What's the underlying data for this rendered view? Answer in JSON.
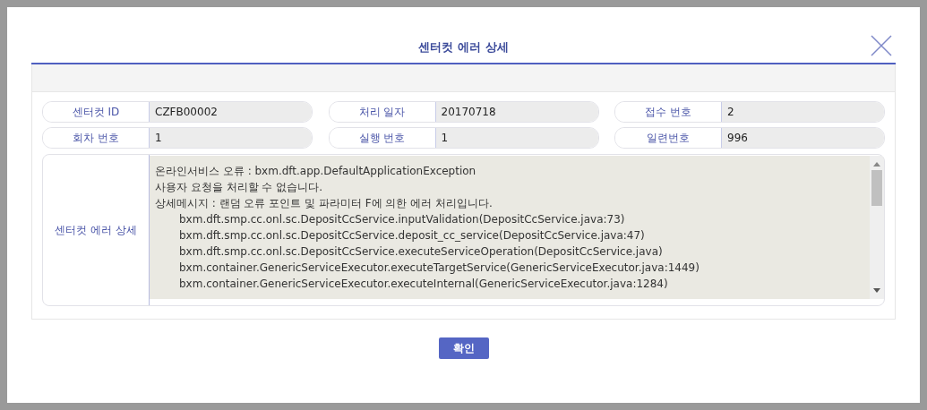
{
  "dialog": {
    "title": "센터컷 에러 상세"
  },
  "fields": [
    {
      "label": "센터컷 ID",
      "value": "CZFB00002"
    },
    {
      "label": "처리 일자",
      "value": "20170718"
    },
    {
      "label": "접수 번호",
      "value": "2"
    },
    {
      "label": "회차 번호",
      "value": "1"
    },
    {
      "label": "실행 번호",
      "value": "1"
    },
    {
      "label": "일련번호",
      "value": "996"
    }
  ],
  "error_detail": {
    "label": "센터컷 에러 상세",
    "lines": [
      {
        "kind": "message",
        "text": "온라인서비스 오류 : bxm.dft.app.DefaultApplicationException"
      },
      {
        "kind": "message",
        "text": "사용자 요청을 처리할 수 없습니다."
      },
      {
        "kind": "message",
        "text": "상세메시지 : 랜덤 오류 포인트 및 파라미터 F에 의한 에러 처리입니다."
      },
      {
        "kind": "trace",
        "text": "bxm.dft.smp.cc.onl.sc.DepositCcService.inputValidation(DepositCcService.java:73)"
      },
      {
        "kind": "trace",
        "text": "bxm.dft.smp.cc.onl.sc.DepositCcService.deposit_cc_service(DepositCcService.java:47)"
      },
      {
        "kind": "trace",
        "text": "bxm.dft.smp.cc.onl.sc.DepositCcService.executeServiceOperation(DepositCcService.java)"
      },
      {
        "kind": "trace",
        "text": "bxm.container.GenericServiceExecutor.executeTargetService(GenericServiceExecutor.java:1449)"
      },
      {
        "kind": "trace",
        "text": "bxm.container.GenericServiceExecutor.executeInternal(GenericServiceExecutor.java:1284)"
      }
    ]
  },
  "buttons": [
    {
      "label": "확인"
    }
  ]
}
